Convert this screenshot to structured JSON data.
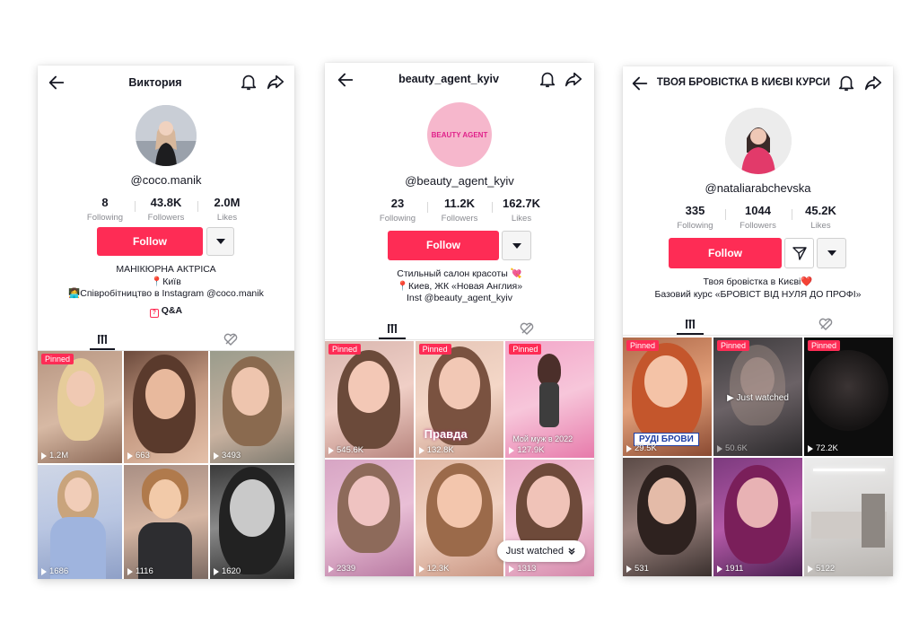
{
  "profiles": [
    {
      "title": "Виктория",
      "handle": "@coco.manik",
      "following": "8",
      "followers": "43.8K",
      "likes": "2.0M",
      "following_label": "Following",
      "followers_label": "Followers",
      "likes_label": "Likes",
      "follow_label": "Follow",
      "bio": [
        "МАНІКЮРНА АКТРІСА",
        "📍Київ",
        "👩‍💻Співробітництво в Instagram @coco.manik"
      ],
      "qa_label": "Q&A",
      "videos": [
        {
          "views": "1.2M",
          "pinned": "Pinned"
        },
        {
          "views": "663"
        },
        {
          "views": "3493"
        },
        {
          "views": "1686"
        },
        {
          "views": "1116"
        },
        {
          "views": "1620"
        }
      ]
    },
    {
      "title": "beauty_agent_kyiv",
      "avatar_text": "BEAUTY AGENT",
      "handle": "@beauty_agent_kyiv",
      "following": "23",
      "followers": "11.2K",
      "likes": "162.7K",
      "following_label": "Following",
      "followers_label": "Followers",
      "likes_label": "Likes",
      "follow_label": "Follow",
      "bio": [
        "Стильный салон красоты 💘",
        "📍Киев, ЖК «Новая Англия»",
        "Inst @beauty_agent_kyiv"
      ],
      "videos": [
        {
          "views": "545.6K",
          "pinned": "Pinned"
        },
        {
          "views": "132.8K",
          "pinned": "Pinned",
          "caption": "Правда"
        },
        {
          "views": "127.9K",
          "pinned": "Pinned",
          "caption": "Мой муж в 2022"
        },
        {
          "views": "2339"
        },
        {
          "views": "12.3K"
        },
        {
          "views": "1313"
        }
      ],
      "just_watched": "Just watched"
    },
    {
      "title": "ТВОЯ БРОВІСТКА В КИЄВІ КУРСИ",
      "handle": "@nataliarabchevska",
      "following": "335",
      "followers": "1044",
      "likes": "45.2K",
      "following_label": "Following",
      "followers_label": "Followers",
      "likes_label": "Likes",
      "follow_label": "Follow",
      "bio": [
        "Твоя бровістка в Києві❤️",
        "Базовий курс «БРОВІСТ ВІД НУЛЯ ДО ПРОФІ»"
      ],
      "videos": [
        {
          "views": "29.5K",
          "pinned": "Pinned",
          "caption": "РУДІ БРОВИ"
        },
        {
          "views": "50.6K",
          "pinned": "Pinned",
          "caption": "Just watched"
        },
        {
          "views": "72.2K",
          "pinned": "Pinned"
        },
        {
          "views": "531"
        },
        {
          "views": "1911"
        },
        {
          "views": "5122"
        }
      ]
    }
  ],
  "colors": {
    "accent": "#fe2c55",
    "text": "#161823",
    "muted": "#8a8b91"
  }
}
